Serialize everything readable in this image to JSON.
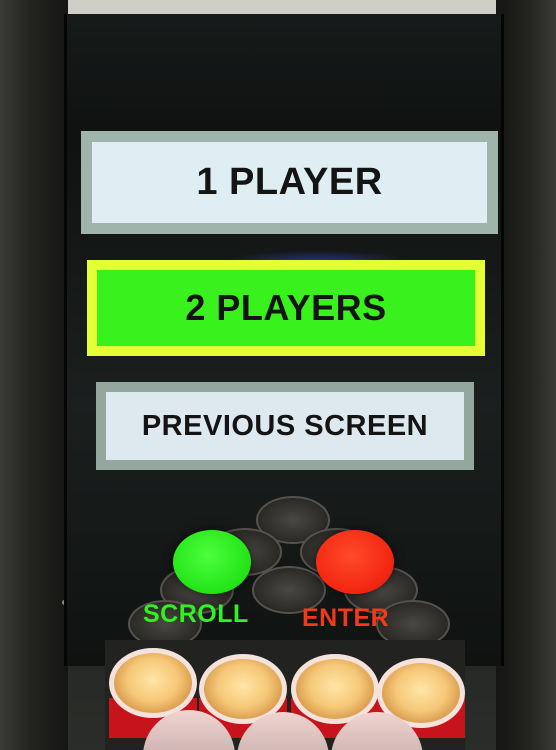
{
  "menu": {
    "options": [
      {
        "label": "1 PLAYER",
        "selected": false
      },
      {
        "label": "2 PLAYERS",
        "selected": true
      },
      {
        "label": "PREVIOUS SCREEN",
        "selected": false
      }
    ]
  },
  "controls": {
    "scroll_label": "SCROLL",
    "enter_label": "ENTER",
    "scroll_color": "#22e318",
    "enter_color": "#f22510"
  },
  "colors": {
    "selected_fill": "#39f21d",
    "selected_border": "#e4ff33",
    "unselected_fill": "#dfeef2",
    "unselected_border": "#9fb4aa"
  }
}
